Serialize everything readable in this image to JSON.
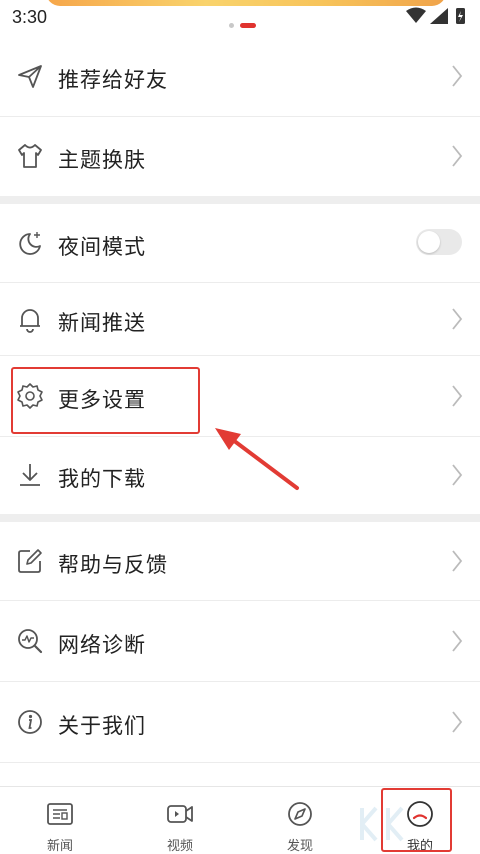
{
  "status_bar": {
    "time": "3:30"
  },
  "menu": {
    "items": [
      {
        "label": "推荐给好友",
        "icon": "send-icon"
      },
      {
        "label": "主题换肤",
        "icon": "shirt-icon"
      },
      {
        "label": "夜间模式",
        "icon": "moon-icon",
        "toggle": "off"
      },
      {
        "label": "新闻推送",
        "icon": "bell-icon"
      },
      {
        "label": "更多设置",
        "icon": "gear-icon"
      },
      {
        "label": "我的下载",
        "icon": "download-icon"
      },
      {
        "label": "帮助与反馈",
        "icon": "edit-icon"
      },
      {
        "label": "网络诊断",
        "icon": "network-diagnosis-icon"
      },
      {
        "label": "关于我们",
        "icon": "info-icon"
      }
    ]
  },
  "tabbar": {
    "tabs": [
      {
        "label": "新闻",
        "icon": "news-icon"
      },
      {
        "label": "视频",
        "icon": "video-icon"
      },
      {
        "label": "发现",
        "icon": "discover-icon"
      },
      {
        "label": "我的",
        "icon": "profile-icon",
        "active": true
      }
    ]
  },
  "colors": {
    "accent": "#e0332f",
    "annotation": "#e23b34",
    "icon": "#555555",
    "chevron": "#bbbbbb"
  }
}
